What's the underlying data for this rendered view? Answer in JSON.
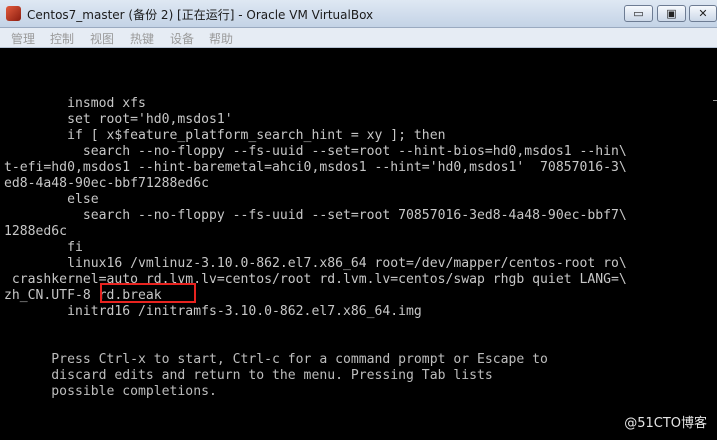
{
  "window": {
    "title": "Centos7_master (备份 2) [正在运行] - Oracle VM VirtualBox",
    "minimize_glyph": "▭",
    "restore_glyph": "▣",
    "close_glyph": "✕",
    "icon": "virtualbox-app-icon"
  },
  "menu": {
    "items": [
      "管理",
      "控制",
      "视图",
      "热键",
      "设备",
      "帮助"
    ]
  },
  "terminal": {
    "lines": [
      "        insmod xfs",
      "        set root='hd0,msdos1'",
      "        if [ x$feature_platform_search_hint = xy ]; then",
      "          search --no-floppy --fs-uuid --set=root --hint-bios=hd0,msdos1 --hin\\",
      "t-efi=hd0,msdos1 --hint-baremetal=ahci0,msdos1 --hint='hd0,msdos1'  70857016-3\\",
      "ed8-4a48-90ec-bbf71288ed6c",
      "        else",
      "          search --no-floppy --fs-uuid --set=root 70857016-3ed8-4a48-90ec-bbf7\\",
      "1288ed6c",
      "        fi",
      "        linux16 /vmlinuz-3.10.0-862.el7.x86_64 root=/dev/mapper/centos-root ro\\",
      " crashkernel=auto rd.lvm.lv=centos/root rd.lvm.lv=centos/swap rhgb quiet LANG=\\",
      "zh_CN.UTF-8 rd.break",
      "        initrd16 /initramfs-3.10.0-862.el7.x86_64.img"
    ],
    "help_lines": [
      "      Press Ctrl-x to start, Ctrl-c for a command prompt or Escape to",
      "      discard edits and return to the menu. Pressing Tab lists",
      "      possible completions."
    ],
    "highlight_color": "#e8231f"
  },
  "watermark": "@51CTO博客"
}
